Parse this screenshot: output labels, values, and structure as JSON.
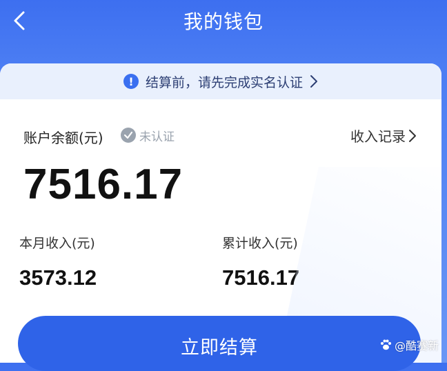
{
  "nav": {
    "title": "我的钱包"
  },
  "notice": {
    "text": "结算前，请先完成实名认证"
  },
  "balance": {
    "label": "账户余额(元)",
    "verify_status": "未认证",
    "records_link": "收入记录",
    "value": "7516.17"
  },
  "stats": {
    "month_label": "本月收入(元)",
    "month_value": "3573.12",
    "total_label": "累计收入(元)",
    "total_value": "7516.17"
  },
  "actions": {
    "settle_label": "立即结算"
  },
  "watermark": {
    "text": "@酷赛新"
  },
  "colors": {
    "header_blue": "#3d6ff0",
    "button_blue": "#2f63e8",
    "notice_bg": "#e9f0fd",
    "muted_gray": "#9aa3ae"
  },
  "icons": {
    "back": "chevron-left-icon",
    "info": "info-circle-icon",
    "notice_arrow": "chevron-right-icon",
    "verify": "check-circle-icon",
    "records_arrow": "chevron-right-icon",
    "watermark": "paw-icon"
  }
}
